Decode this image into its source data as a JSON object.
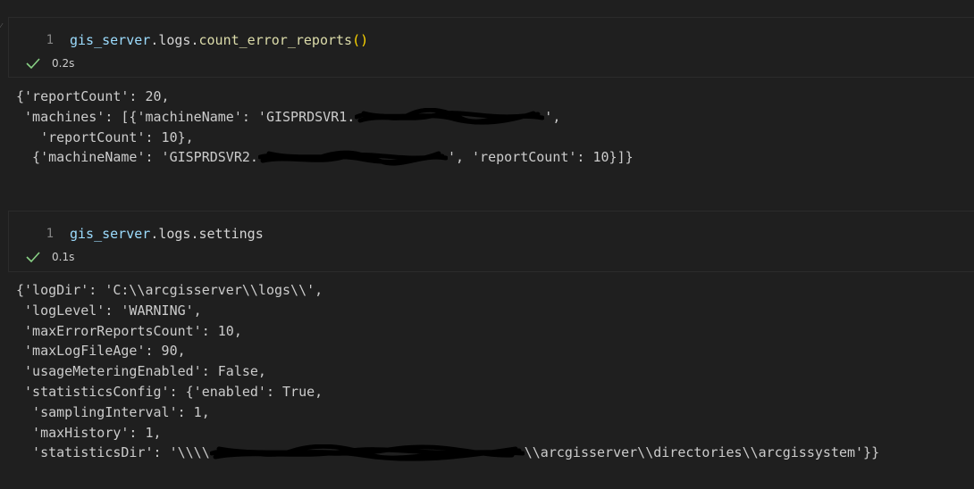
{
  "cells": [
    {
      "line_number": "1",
      "code": {
        "object": "gis_server",
        "dot1": ".",
        "module": "logs",
        "dot2": ".",
        "method": "count_error_reports",
        "parens": "()"
      },
      "status": {
        "time": "0.2s"
      },
      "output": [
        "{'reportCount': 20,",
        " 'machines': [{'machineName': 'GISPRDSVR1.",
        "', ",
        "   'reportCount': 10},",
        "  {'machineName': 'GISPRDSVR2.",
        "', 'reportCount': 10}]}"
      ]
    },
    {
      "line_number": "1",
      "code": {
        "object": "gis_server",
        "dot1": ".",
        "module": "logs",
        "dot2": ".",
        "attribute": "settings"
      },
      "status": {
        "time": "0.1s"
      },
      "output": [
        "{'logDir': 'C:\\\\arcgisserver\\\\logs\\\\',",
        " 'logLevel': 'WARNING',",
        " 'maxErrorReportsCount': 10,",
        " 'maxLogFileAge': 90,",
        " 'usageMeteringEnabled': False,",
        " 'statisticsConfig': {'enabled': True,",
        "  'samplingInterval': 1,",
        "  'maxHistory': 1,",
        "  'statisticsDir': '\\\\\\\\",
        "\\\\arcgisserver\\\\directories\\\\arcgissystem'}}"
      ]
    }
  ],
  "icons": {
    "status": "check-icon",
    "redaction": "scribble-redaction"
  },
  "colors": {
    "background": "#1f1f1f",
    "success": "#89d185",
    "variable": "#9cdcfe",
    "function": "#dcdcaa",
    "paren": "#ffd700"
  }
}
